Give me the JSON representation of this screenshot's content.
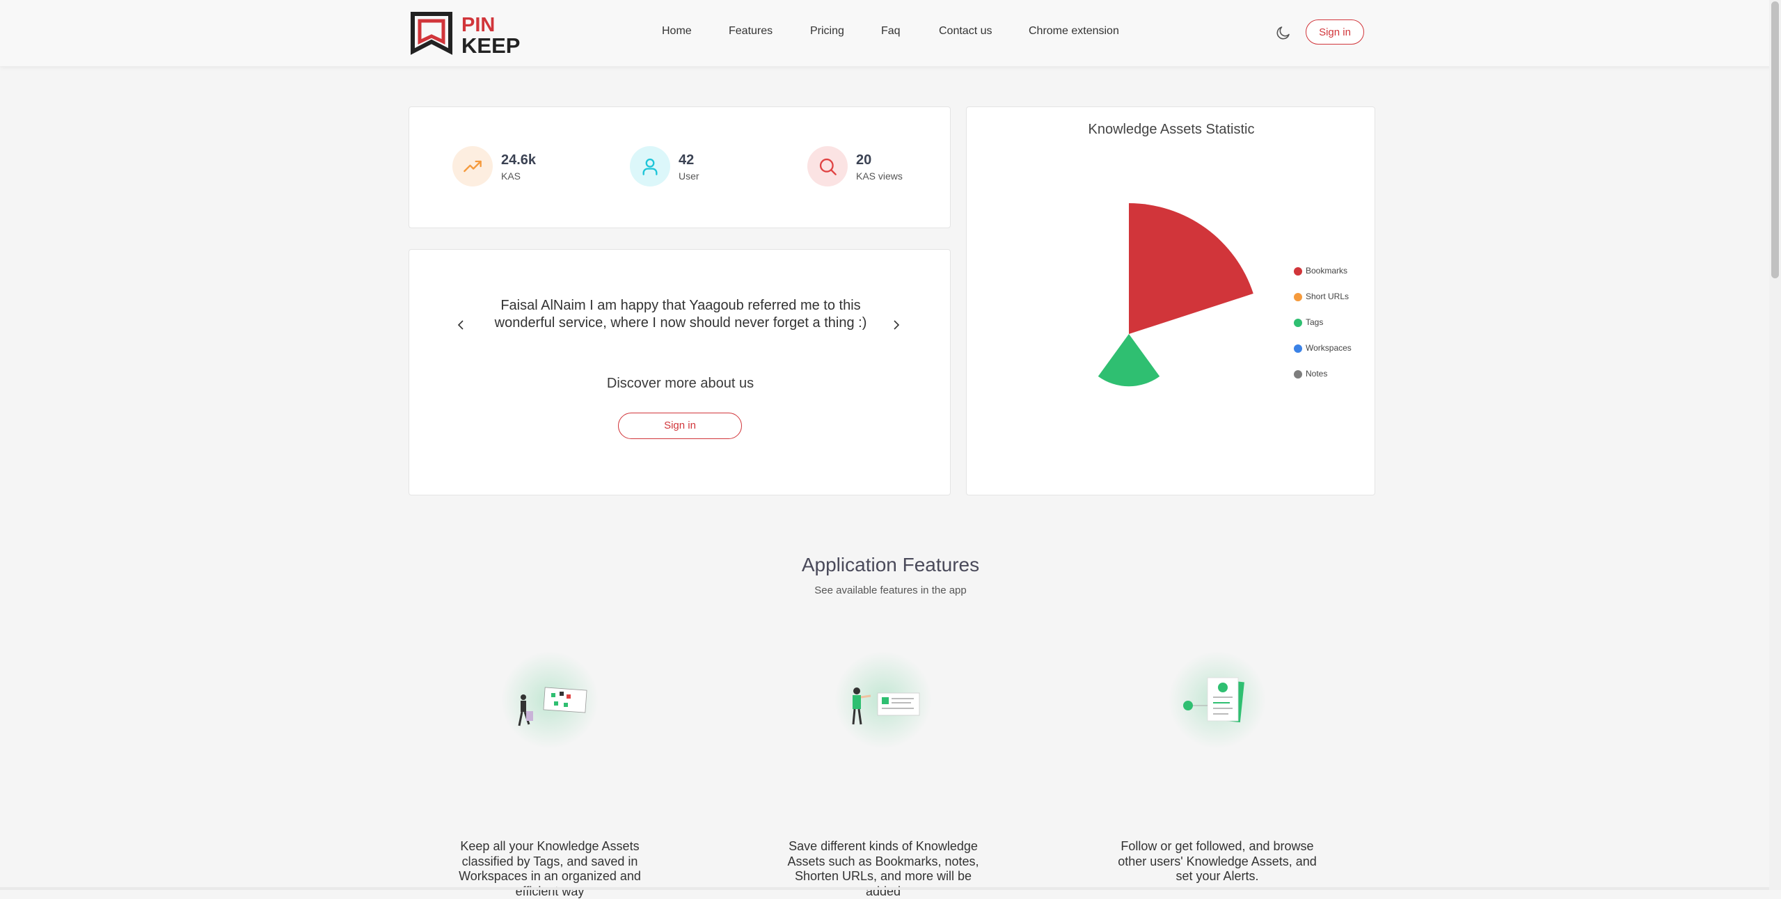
{
  "header": {
    "logo": {
      "text_top": "PIN",
      "text_bottom": "KEEP"
    },
    "nav": [
      "Home",
      "Features",
      "Pricing",
      "Faq",
      "Contact us",
      "Chrome extension"
    ],
    "theme_icon": "moon-icon",
    "signin_label": "Sign in"
  },
  "stats": [
    {
      "value": "24.6k",
      "label": "KAS",
      "icon": "trending-up-icon",
      "color": "#f59a3c",
      "bg": "#fdeee0"
    },
    {
      "value": "42",
      "label": "User",
      "icon": "user-icon",
      "color": "#1ec5d8",
      "bg": "#dcf7fa"
    },
    {
      "value": "20",
      "label": "KAS views",
      "icon": "search-icon",
      "color": "#e04343",
      "bg": "#fbe3e3"
    }
  ],
  "testimonial": {
    "text": "Faisal AlNaim I am happy that Yaagoub referred me to this wonderful service, where I now should never forget a thing :)",
    "discover": "Discover more about us",
    "signin_label": "Sign in"
  },
  "chart_data": {
    "type": "pie",
    "title": "Knowledge Assets Statistic",
    "variant": "polar-area",
    "series": [
      {
        "name": "Bookmarks",
        "color": "#d1353a",
        "value": 100
      },
      {
        "name": "Short URLs",
        "color": "#f59a3c",
        "value": 0
      },
      {
        "name": "Tags",
        "color": "#2fbf71",
        "value": 16
      },
      {
        "name": "Workspaces",
        "color": "#3b82e6",
        "value": 0
      },
      {
        "name": "Notes",
        "color": "#7d7d7d",
        "value": 0
      }
    ],
    "legend": "right"
  },
  "features": {
    "title": "Application Features",
    "subtitle": "See available features in the app",
    "items": [
      {
        "text": "Keep all your Knowledge Assets classified by Tags, and saved in Workspaces in an organized and efficient way",
        "illustration": "tags-board-illustration"
      },
      {
        "text": "Save different kinds of Knowledge Assets such as Bookmarks, notes, Shorten URLs, and more will be added",
        "illustration": "presenting-board-illustration"
      },
      {
        "text": "Follow or get followed, and browse other users' Knowledge Assets, and set your Alerts.",
        "illustration": "profile-cards-illustration"
      }
    ]
  }
}
